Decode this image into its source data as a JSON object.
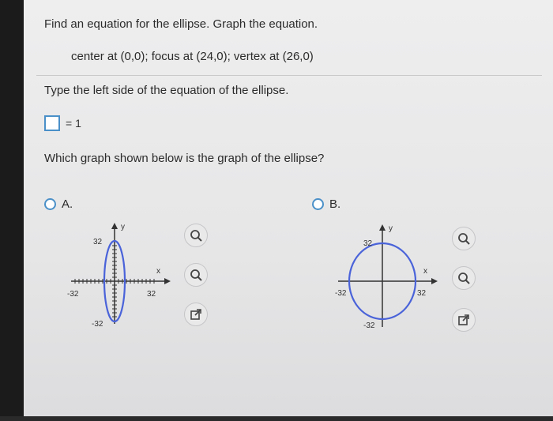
{
  "question": {
    "prompt": "Find an equation for the ellipse. Graph the equation.",
    "given": "center at (0,0); focus at (24,0); vertex at (26,0)",
    "type_label": "Type the left side of the equation of the ellipse.",
    "equation_suffix": "= 1",
    "which_graph": "Which graph shown below is the graph of the ellipse?"
  },
  "answer_input": {
    "value": ""
  },
  "options": [
    {
      "label": "A.",
      "graph": {
        "x_axis_label": "x",
        "y_axis_label": "y",
        "tick_neg_x": "-32",
        "tick_pos_x": "32",
        "tick_pos_y": "32",
        "tick_neg_y": "-32"
      }
    },
    {
      "label": "B.",
      "graph": {
        "x_axis_label": "x",
        "y_axis_label": "y",
        "tick_neg_x": "-32",
        "tick_pos_x": "32",
        "tick_pos_y": "32",
        "tick_neg_y": "-32"
      }
    }
  ],
  "tools": [
    "zoom-in-icon",
    "zoom-out-icon",
    "popout-icon"
  ],
  "colors": {
    "ellipse": "#4a63d9",
    "radio": "#4a90c8",
    "text": "#2b2b2b"
  }
}
